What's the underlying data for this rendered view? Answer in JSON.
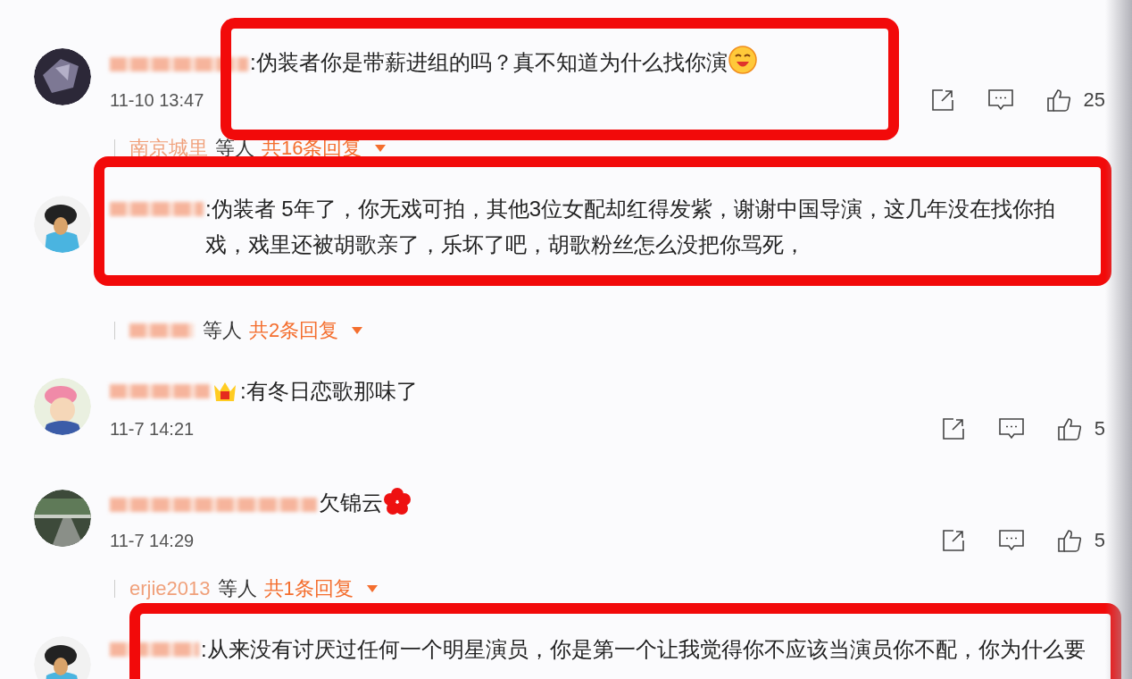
{
  "comments": [
    {
      "text": ":伪装者你是带薪进组的吗？真不知道为什么找你演",
      "emoji_after": {
        "kind": "laughing"
      },
      "time": "11-10 13:47",
      "likes": "25",
      "replies": {
        "name": "南京城里",
        "others": "等人",
        "count": "共16条回复"
      },
      "highlighted": true
    },
    {
      "text": ":伪装者 5年了，你无戏可拍，其他3位女配却红得发紫，谢谢中国导演，这几年没在找你拍戏，戏里还被胡歌亲了，乐坏了吧，胡歌粉丝怎么没把你骂死，",
      "replies": {
        "others": "等人",
        "count": "共2条回复"
      },
      "highlighted": true
    },
    {
      "emoji_before": {
        "kind": "crown"
      },
      "text": ":有冬日恋歌那味了",
      "time": "11-7 14:21",
      "likes": "5",
      "highlighted": false
    },
    {
      "text": "欠锦云",
      "emoji_after": {
        "kind": "flower"
      },
      "time": "11-7 14:29",
      "likes": "5",
      "replies": {
        "name": "erjie2013",
        "others": "等人",
        "count": "共1条回复"
      },
      "highlighted": false
    },
    {
      "text": ":从来没有讨厌过任何一个明星演员，你是第一个让我觉得你不应该当演员你不配，你为什么要",
      "highlighted": true
    }
  ]
}
